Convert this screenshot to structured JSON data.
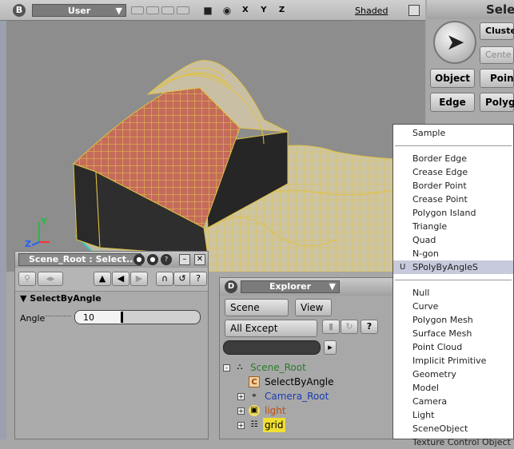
{
  "viewport": {
    "letter": "B",
    "camera": "User",
    "axes": "X Y Z",
    "shading": "Shaded",
    "gizmo": {
      "y": "Y",
      "z": "Z"
    }
  },
  "right_panel": {
    "title": "Sele",
    "cluster_label": "Cluste",
    "center_label": "Cente",
    "object_label": "Object",
    "point_label": "Point",
    "edge_label": "Edge",
    "polygon_label": "Polygo"
  },
  "scene_panel": {
    "title": "Scene_Root : Select...",
    "section": "SelectByAngle",
    "angle_label": "Angle",
    "angle_value": "10",
    "angle_fraction": 0.38
  },
  "explorer": {
    "letter": "D",
    "title": "Explorer",
    "scope_button": "Scene Root",
    "view_button": "View",
    "filter_button": "All Except Params",
    "tree": [
      {
        "label": "Scene_Root",
        "color": "#2a7a2a",
        "icon": "scene-root-icon",
        "depth": 0,
        "expander": "-"
      },
      {
        "label": "SelectByAngle",
        "color": "#000000",
        "icon": "custom-operator-icon",
        "depth": 1,
        "expander": ""
      },
      {
        "label": "Camera_Root",
        "color": "#1a3bb0",
        "icon": "camera-root-icon",
        "depth": 1,
        "expander": "+"
      },
      {
        "label": "light",
        "color": "#c05010",
        "icon": "light-icon",
        "depth": 1,
        "expander": "+"
      },
      {
        "label": "grid",
        "color": "#000000",
        "icon": "grid-icon",
        "depth": 1,
        "expander": "+",
        "highlight": true
      }
    ]
  },
  "menu": {
    "items": [
      {
        "label": "Sample"
      },
      {
        "sep": true
      },
      {
        "label": "Border Edge"
      },
      {
        "label": "Crease Edge"
      },
      {
        "label": "Border Point"
      },
      {
        "label": "Crease Point"
      },
      {
        "label": "Polygon Island"
      },
      {
        "label": "Triangle"
      },
      {
        "label": "Quad"
      },
      {
        "label": "N-gon"
      },
      {
        "label": "SPolyByAngleS",
        "marker": "U",
        "selected": true
      },
      {
        "sep": true
      },
      {
        "label": "Null"
      },
      {
        "label": "Curve"
      },
      {
        "label": "Polygon Mesh"
      },
      {
        "label": "Surface Mesh"
      },
      {
        "label": "Point Cloud"
      },
      {
        "label": "Implicit Primitive"
      },
      {
        "label": "Geometry"
      },
      {
        "label": "Model"
      },
      {
        "label": "Camera"
      },
      {
        "label": "Light"
      },
      {
        "label": "SceneObject"
      },
      {
        "label": "Texture Control Object"
      }
    ]
  }
}
